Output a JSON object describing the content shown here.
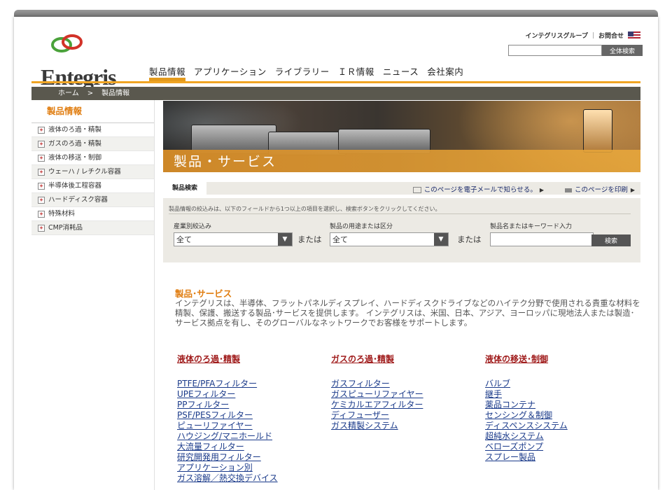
{
  "brand": {
    "logo_text": "Entegris"
  },
  "utility": {
    "group_label": "インテグリスグループ",
    "contact_label": "お問合せ",
    "search_button": "全体検索",
    "search_value": ""
  },
  "nav": {
    "items": [
      "製品情報",
      "アプリケーション",
      "ライブラリー",
      "ＩＲ情報",
      "ニュース",
      "会社案内"
    ]
  },
  "breadcrumb": {
    "home": "ホーム",
    "separator": ">",
    "current": "製品情報"
  },
  "sidebar": {
    "title": "製品情報",
    "items": [
      "液体のろ過・精製",
      "ガスのろ過・精製",
      "液体の移送・制御",
      "ウェーハ / レチクル容器",
      "半導体後工程容器",
      "ハードディスク容器",
      "特殊材料",
      "CMP消耗品"
    ]
  },
  "hero": {
    "title": "製品・サービス"
  },
  "search_panel": {
    "tab": "製品検索",
    "email_link": "このページを電子メールで知らせる。",
    "print_link": "このページを印刷",
    "instructions": "製品情報の絞込みは、以下のフィールドから1つ以上の項目を選択し、検索ボタンをクリックしてください。",
    "industry_label": "産業別絞込み",
    "industry_value": "全て",
    "or_label": "または",
    "usage_label": "製品の用途または区分",
    "usage_value": "全て",
    "keyword_label": "製品名またはキーワード入力",
    "keyword_value": "",
    "search_button": "検索"
  },
  "content": {
    "title": "製品･サービス",
    "intro": "インテグリスは、半導体、フラットパネルディスプレイ、ハードディスクドライブなどのハイテク分野で使用される貴重な材料を精製、保護、搬送する製品･サービスを提供します。 インテグリスは、米国、日本、アジア、ヨーロッパに現地法人または製造･サービス拠点を有し、そのグローバルなネットワークでお客様をサポートします。",
    "columns": [
      {
        "heading": "液体のろ過･精製",
        "links": [
          "PTFE/PFAフィルター",
          "UPEフィルター",
          "PPフィルター",
          "PSF/PESフィルター",
          "ピューリファイヤー",
          "ハウジング/マニホールド",
          "大流量フィルター",
          "研究開発用フィルター",
          "アプリケーション別",
          "ガス溶解／熱交換デバイス"
        ]
      },
      {
        "heading": "ガスのろ過･精製",
        "links": [
          "ガスフィルター",
          "ガスピューリファイヤー",
          "ケミカルエアフィルター",
          "ディフューザー",
          "ガス精製システム"
        ]
      },
      {
        "heading": "液体の移送･制御",
        "links": [
          "バルブ",
          "継手",
          "薬品コンテナ",
          "センシング＆制御",
          "ディスペンスシステム",
          "超純水システム",
          "ベローズポンプ",
          "スプレー製品"
        ]
      }
    ]
  },
  "colors": {
    "accent": "#f0a524",
    "heading": "#e07d10",
    "link": "#1a3a8a",
    "column_heading": "#a01c1c",
    "breadcrumb_bg": "#5a584e"
  }
}
